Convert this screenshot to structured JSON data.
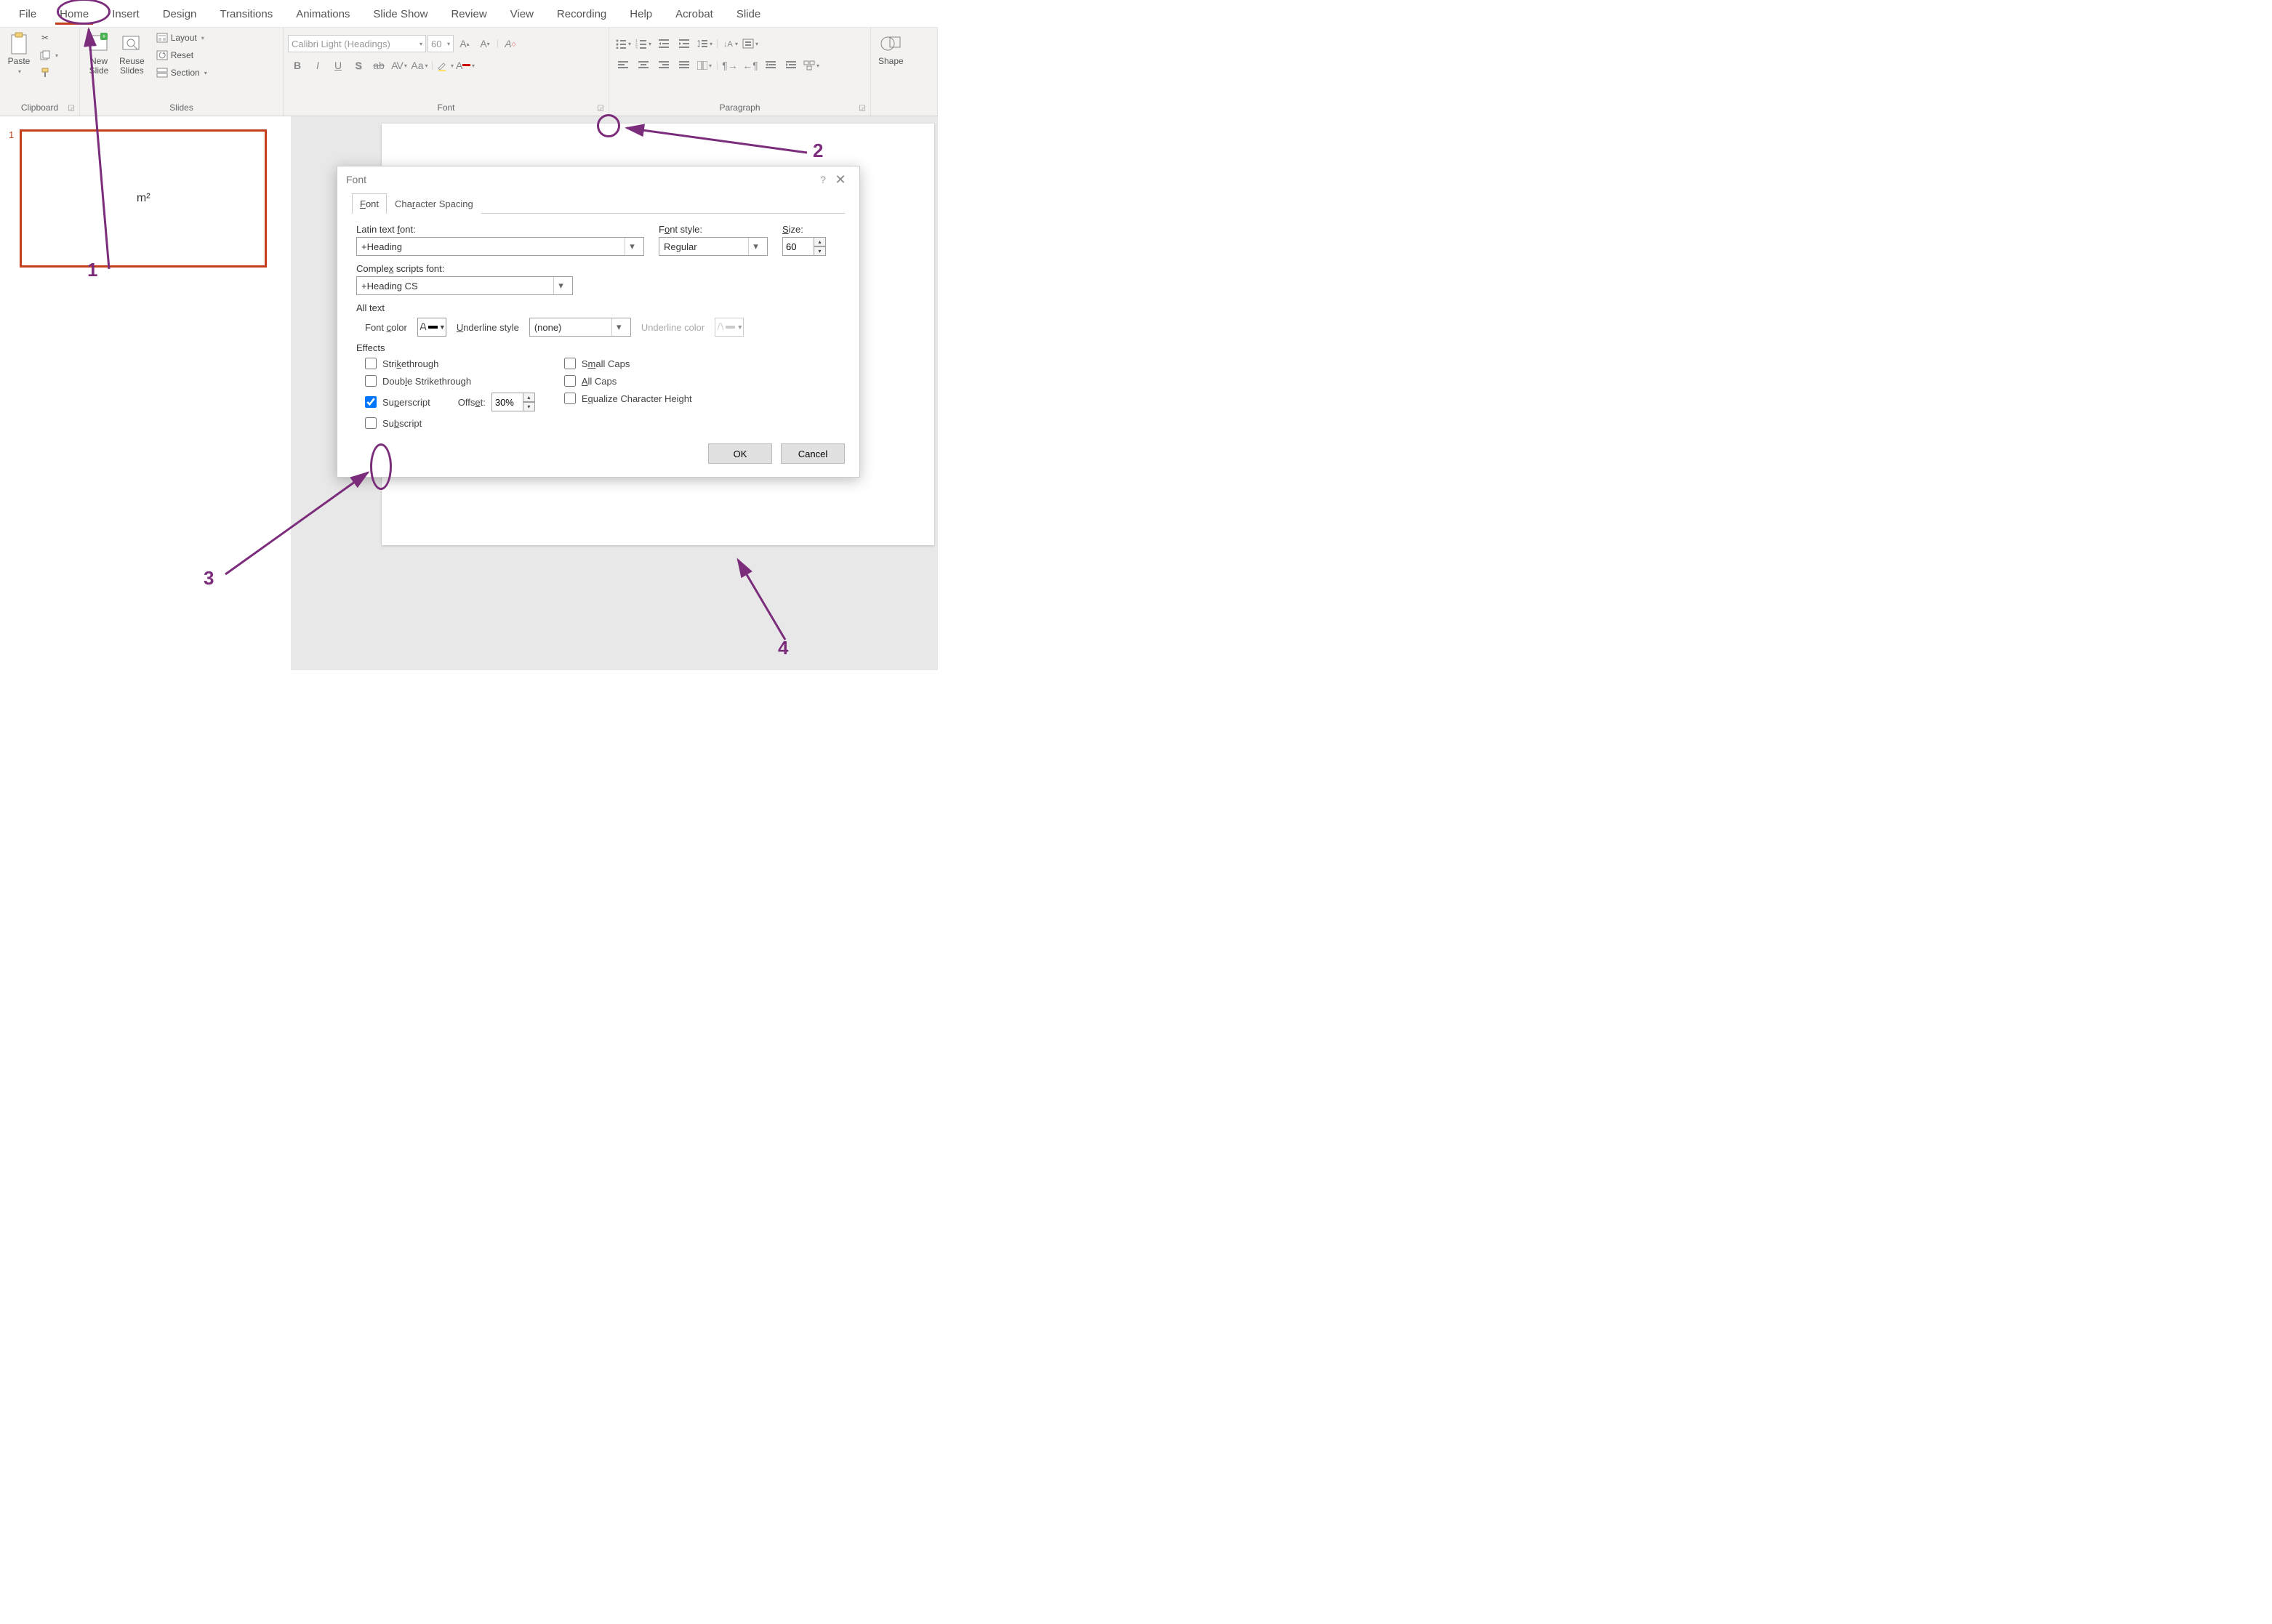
{
  "tabs": {
    "items": [
      "File",
      "Home",
      "Insert",
      "Design",
      "Transitions",
      "Animations",
      "Slide Show",
      "Review",
      "View",
      "Recording",
      "Help",
      "Acrobat",
      "Slide"
    ],
    "active": "Home"
  },
  "ribbon": {
    "clipboard": {
      "label": "Clipboard",
      "paste": "Paste"
    },
    "slides": {
      "label": "Slides",
      "new_slide": "New\nSlide",
      "reuse": "Reuse\nSlides",
      "layout": "Layout",
      "reset": "Reset",
      "section": "Section"
    },
    "font": {
      "label": "Font",
      "name_placeholder": "Calibri Light (Headings)",
      "size_placeholder": "60"
    },
    "paragraph": {
      "label": "Paragraph"
    },
    "shapes": {
      "label": "Shape"
    }
  },
  "thumb": {
    "number": "1",
    "content": "m²"
  },
  "dialog": {
    "title": "Font",
    "tabs": {
      "font": "Font",
      "spacing": "Character Spacing"
    },
    "latin_label": "Latin text font:",
    "latin_value": "+Heading",
    "style_label": "Font style:",
    "style_value": "Regular",
    "size_label": "Size:",
    "size_value": "60",
    "complex_label": "Complex scripts font:",
    "complex_value": "+Heading CS",
    "alltext_label": "All text",
    "fontcolor_label": "Font color",
    "underline_label": "Underline style",
    "underline_value": "(none)",
    "underline_color_label": "Underline color",
    "effects_label": "Effects",
    "strike": "Strikethrough",
    "dstrike": "Double Strikethrough",
    "superscript": "Superscript",
    "subscript": "Subscript",
    "offset_label": "Offset:",
    "offset_value": "30%",
    "smallcaps": "Small Caps",
    "allcaps": "All Caps",
    "equalize": "Equalize Character Height",
    "ok": "OK",
    "cancel": "Cancel"
  },
  "annotations": {
    "n1": "1",
    "n2": "2",
    "n3": "3",
    "n4": "4"
  }
}
